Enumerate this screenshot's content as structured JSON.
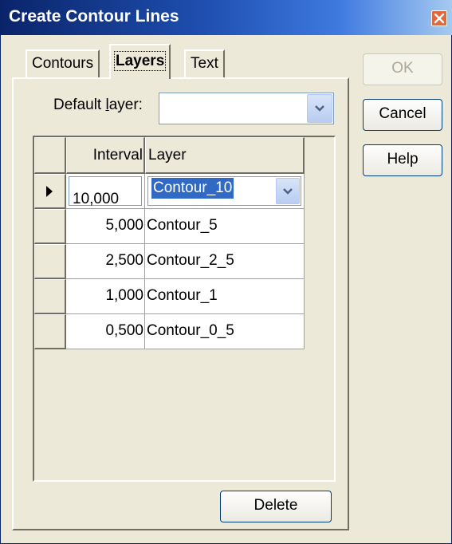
{
  "window": {
    "title": "Create Contour Lines"
  },
  "tabs": [
    {
      "label": "Contours"
    },
    {
      "label": "Layers"
    },
    {
      "label": "Text"
    }
  ],
  "default_layer": {
    "label_pre": "Default ",
    "label_accel": "l",
    "label_post": "ayer:",
    "value": ""
  },
  "grid": {
    "headers": {
      "interval": "Interval",
      "layer": "Layer"
    },
    "rows": [
      {
        "interval": "10,000",
        "layer": "Contour_10",
        "current": true
      },
      {
        "interval": "5,000",
        "layer": "Contour_5"
      },
      {
        "interval": "2,500",
        "layer": "Contour_2_5"
      },
      {
        "interval": "1,000",
        "layer": "Contour_1"
      },
      {
        "interval": "0,500",
        "layer": "Contour_0_5"
      }
    ]
  },
  "buttons": {
    "ok": "OK",
    "cancel": "Cancel",
    "help": "Help",
    "delete": "Delete"
  }
}
